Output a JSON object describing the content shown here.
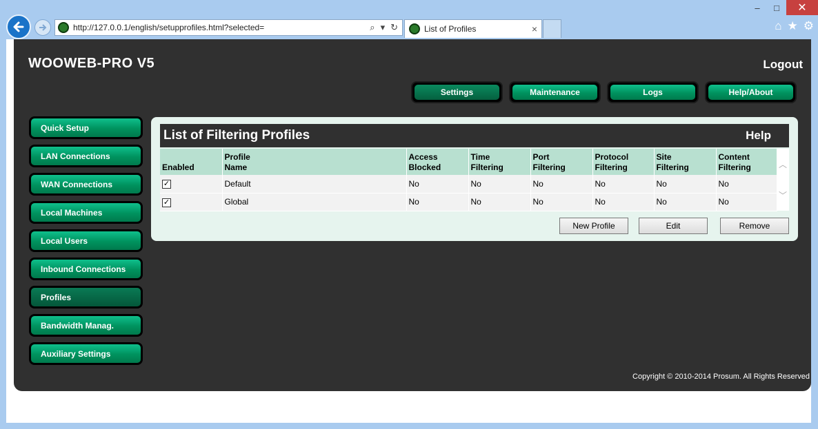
{
  "browser": {
    "url": "http://127.0.0.1/english/setupprofiles.html?selected=",
    "tab_title": "List of Profiles",
    "window_controls": {
      "minimize": "–",
      "maximize": "□",
      "close": "✕"
    }
  },
  "app": {
    "title": "WOOWEB-PRO V5",
    "logout": "Logout",
    "top_nav": [
      {
        "label": "Settings",
        "active": true
      },
      {
        "label": "Maintenance",
        "active": false
      },
      {
        "label": "Logs",
        "active": false
      },
      {
        "label": "Help/About",
        "active": false
      }
    ],
    "side_nav": [
      {
        "label": "Quick Setup",
        "active": false
      },
      {
        "label": "LAN Connections",
        "active": false
      },
      {
        "label": "WAN Connections",
        "active": false
      },
      {
        "label": "Local Machines",
        "active": false
      },
      {
        "label": "Local Users",
        "active": false
      },
      {
        "label": "Inbound Connections",
        "active": false
      },
      {
        "label": "Profiles",
        "active": true
      },
      {
        "label": "Bandwidth Manag.",
        "active": false
      },
      {
        "label": "Auxiliary Settings",
        "active": false
      }
    ],
    "copyright": "Copyright © 2010-2014 Prosum. All Rights Reserved"
  },
  "panel": {
    "title": "List of Filtering Profiles",
    "help": "Help",
    "columns": [
      {
        "line1": "",
        "line2": "Enabled"
      },
      {
        "line1": "Profile",
        "line2": "Name"
      },
      {
        "line1": "Access",
        "line2": "Blocked"
      },
      {
        "line1": "Time",
        "line2": "Filtering"
      },
      {
        "line1": "Port",
        "line2": "Filtering"
      },
      {
        "line1": "Protocol",
        "line2": "Filtering"
      },
      {
        "line1": "Site",
        "line2": "Filtering"
      },
      {
        "line1": "Content",
        "line2": "Filtering"
      }
    ],
    "rows": [
      {
        "enabled": true,
        "name": "Default",
        "access": "No",
        "time": "No",
        "port": "No",
        "protocol": "No",
        "site": "No",
        "content": "No"
      },
      {
        "enabled": true,
        "name": "Global",
        "access": "No",
        "time": "No",
        "port": "No",
        "protocol": "No",
        "site": "No",
        "content": "No"
      }
    ],
    "buttons": {
      "new_profile": "New Profile",
      "edit": "Edit",
      "remove": "Remove"
    }
  },
  "colors": {
    "accent_green": "#00925e",
    "header_teal": "#b8e0d0",
    "app_bg": "#303030"
  }
}
